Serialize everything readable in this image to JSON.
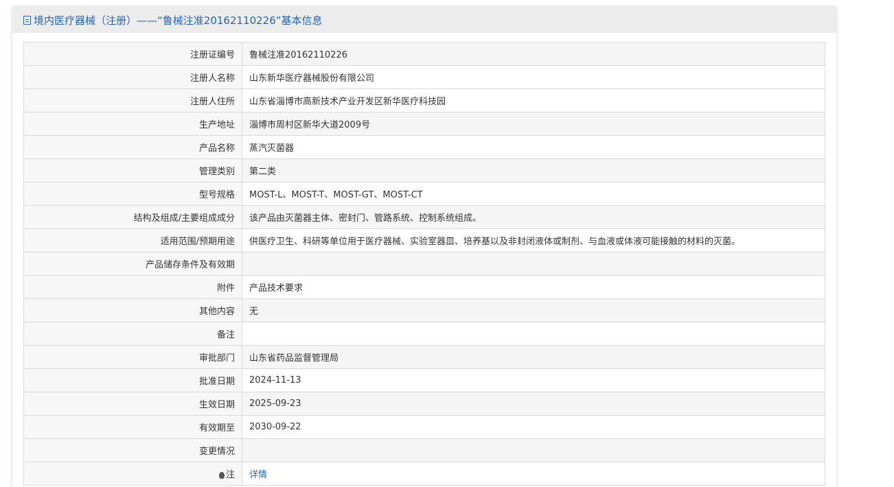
{
  "header": {
    "title": "境内医疗器械（注册）——“鲁械注准20162110226”基本信息",
    "icon": "document-icon"
  },
  "rows": [
    {
      "label": "注册证编号",
      "value": "鲁械注准20162110226",
      "shaded": true
    },
    {
      "label": "注册人名称",
      "value": "山东新华医疗器械股份有限公司",
      "shaded": false
    },
    {
      "label": "注册人住所",
      "value": "山东省淄博市高新技术产业开发区新华医疗科技园",
      "shaded": false
    },
    {
      "label": "生产地址",
      "value": "淄博市周村区新华大道2009号",
      "shaded": true
    },
    {
      "label": "产品名称",
      "value": "蒸汽灭菌器",
      "shaded": false
    },
    {
      "label": "管理类别",
      "value": "第二类",
      "shaded": true
    },
    {
      "label": "型号规格",
      "value": "MOST-L、MOST-T、MOST-GT、MOST-CT",
      "shaded": false
    },
    {
      "label": "结构及组成/主要组成成分",
      "value": "该产品由灭菌器主体、密封门、管路系统、控制系统组成。",
      "shaded": true
    },
    {
      "label": "适用范围/预期用途",
      "value": "供医疗卫生、科研等单位用于医疗器械、实验室器皿、培养基以及非封闭液体或制剂、与血液或体液可能接触的材料的灭菌。",
      "shaded": false
    },
    {
      "label": "产品储存条件及有效期",
      "value": "",
      "shaded": true
    },
    {
      "label": "附件",
      "value": "产品技术要求",
      "shaded": false
    },
    {
      "label": "其他内容",
      "value": "无",
      "shaded": true
    },
    {
      "label": "备注",
      "value": "",
      "shaded": false
    },
    {
      "label": "审批部门",
      "value": "山东省药品监督管理局",
      "shaded": true
    },
    {
      "label": "批准日期",
      "value": "2024-11-13",
      "shaded": false
    },
    {
      "label": "生效日期",
      "value": "2025-09-23",
      "shaded": true
    },
    {
      "label": "有效期至",
      "value": "2030-09-22",
      "shaded": false
    },
    {
      "label": "变更情况",
      "value": "",
      "shaded": true
    }
  ],
  "note_row": {
    "label": "注",
    "icon": "lightbulb-icon",
    "link_text": "详情"
  },
  "colors": {
    "accent": "#2466ac",
    "header_bg": "#ececec",
    "border": "#d9d9d9"
  }
}
